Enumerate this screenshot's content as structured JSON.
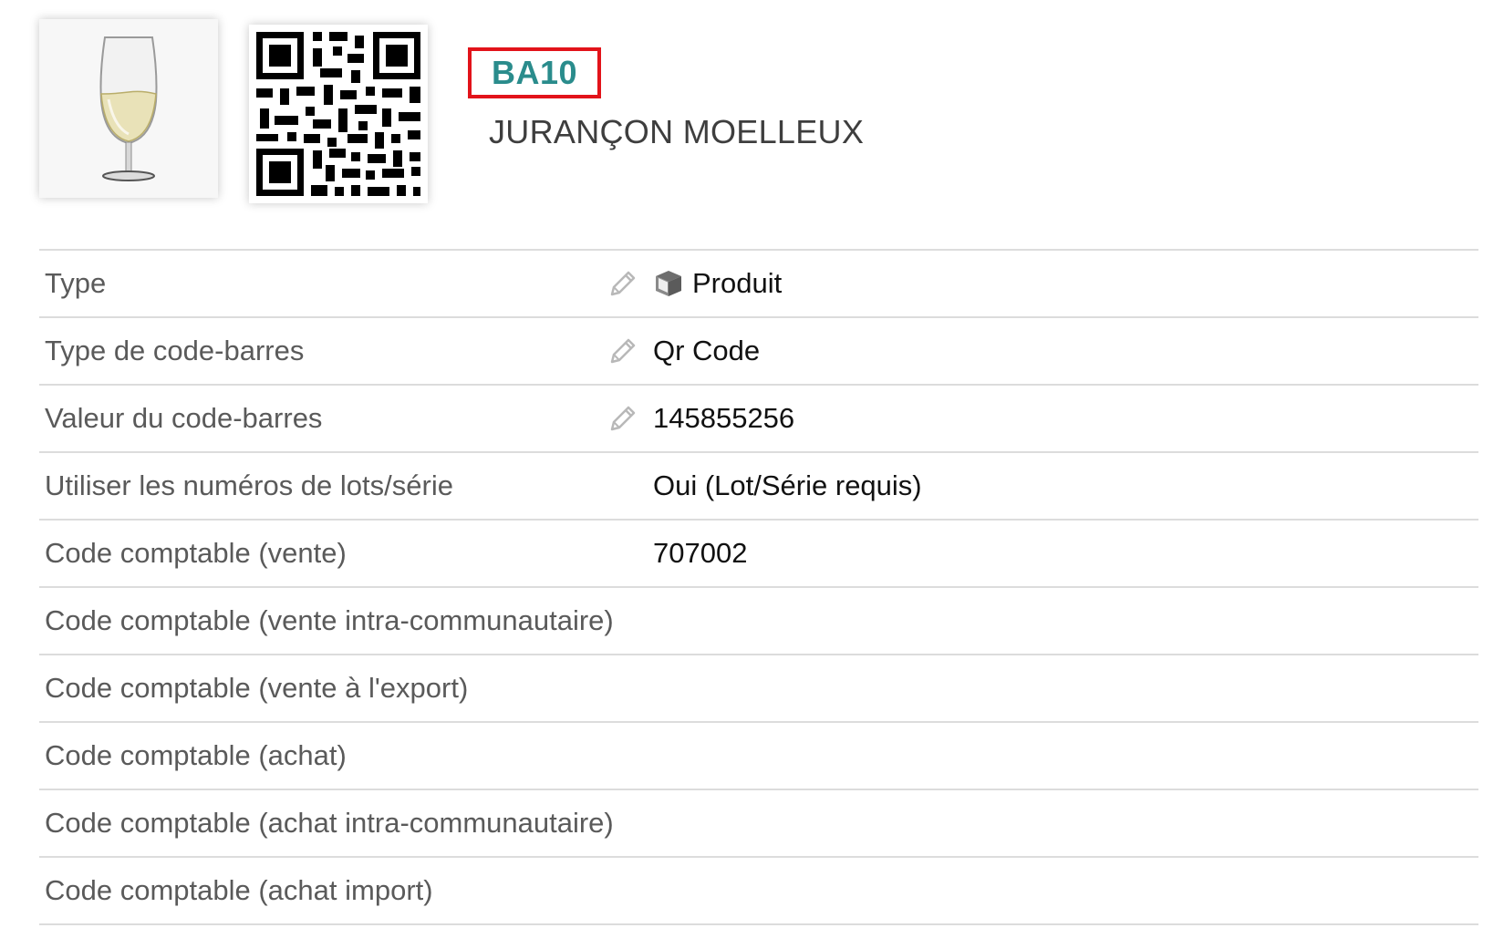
{
  "header": {
    "ref": "BA10",
    "label": "JURANÇON MOELLEUX",
    "colors": {
      "ref_text": "#2a8c8c",
      "ref_highlight_border": "#e2131a"
    }
  },
  "images": {
    "photo_icon": "wine-glass-icon",
    "qr_icon": "qr-code-icon"
  },
  "fields": [
    {
      "label": "Type",
      "value": "Produit",
      "editable": true,
      "value_icon": "cube-icon"
    },
    {
      "label": "Type de code-barres",
      "value": "Qr Code",
      "editable": true
    },
    {
      "label": "Valeur du code-barres",
      "value": "145855256",
      "editable": true
    },
    {
      "label": "Utiliser les numéros de lots/série",
      "value": "Oui (Lot/Série requis)",
      "editable": false
    },
    {
      "label": "Code comptable (vente)",
      "value": "707002",
      "editable": false
    },
    {
      "label": "Code comptable (vente intra-communautaire)",
      "value": "",
      "editable": false
    },
    {
      "label": "Code comptable (vente à l'export)",
      "value": "",
      "editable": false
    },
    {
      "label": "Code comptable (achat)",
      "value": "",
      "editable": false
    },
    {
      "label": "Code comptable (achat intra-communautaire)",
      "value": "",
      "editable": false
    },
    {
      "label": "Code comptable (achat import)",
      "value": "",
      "editable": false
    }
  ]
}
